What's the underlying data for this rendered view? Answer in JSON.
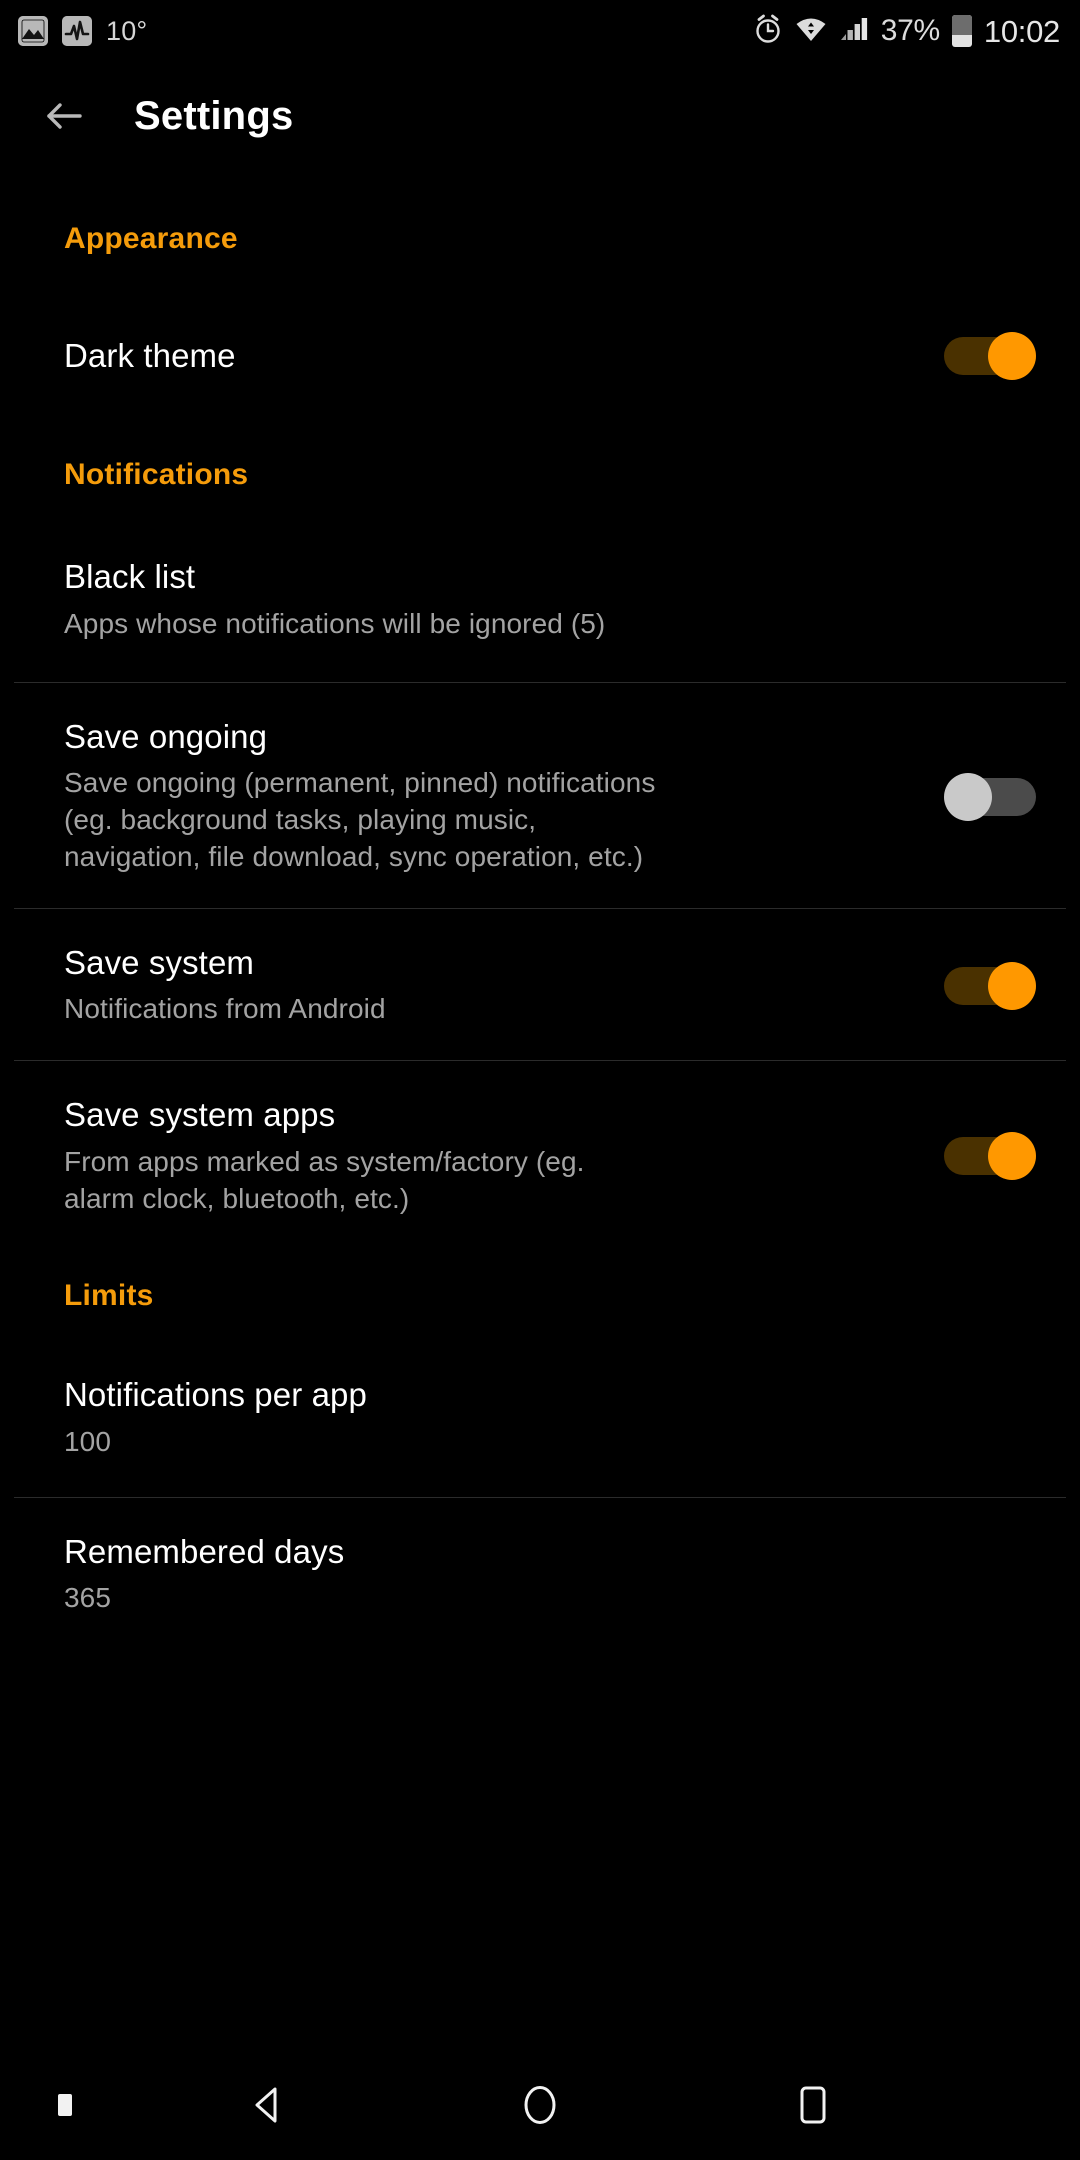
{
  "status_bar": {
    "left_icons": [
      {
        "name": "gallery-icon",
        "label": "gallery"
      },
      {
        "name": "activity-graph-icon",
        "label": "activity"
      }
    ],
    "temperature": "10°",
    "right_icons": [
      {
        "name": "alarm-icon",
        "label": "alarm"
      },
      {
        "name": "wifi-icon",
        "label": "wifi"
      },
      {
        "name": "signal-icon",
        "label": "cellular-signal"
      }
    ],
    "battery_percent": "37%",
    "clock": "10:02"
  },
  "app_bar": {
    "back_label": "Back",
    "title": "Settings"
  },
  "sections": [
    {
      "header": "Appearance",
      "rows": [
        {
          "title": "Dark theme",
          "subtitle": "",
          "control": "switch",
          "state": "on"
        }
      ]
    },
    {
      "header": "Notifications",
      "rows": [
        {
          "title": "Black list",
          "subtitle": "Apps whose notifications will be ignored (5)",
          "control": "none",
          "state": ""
        },
        {
          "title": "Save ongoing",
          "subtitle": "Save ongoing (permanent, pinned) notifications\n(eg. background tasks, playing music,\nnavigation, file download, sync operation, etc.)",
          "control": "switch",
          "state": "off"
        },
        {
          "title": "Save system",
          "subtitle": "Notifications from Android",
          "control": "switch",
          "state": "on"
        },
        {
          "title": "Save system apps",
          "subtitle": "From apps marked as system/factory (eg.\nalarm clock, bluetooth, etc.)",
          "control": "switch",
          "state": "on"
        }
      ]
    },
    {
      "header": "Limits",
      "rows": [
        {
          "title": "Notifications per app",
          "subtitle": "100",
          "control": "none",
          "state": ""
        },
        {
          "title": "Remembered days",
          "subtitle": "365",
          "control": "none",
          "state": ""
        }
      ]
    }
  ],
  "nav_bar": {
    "items": [
      {
        "name": "nav-back",
        "label": "Back"
      },
      {
        "name": "nav-home",
        "label": "Home"
      },
      {
        "name": "nav-recents",
        "label": "Recents"
      }
    ]
  },
  "colors": {
    "background": "#000000",
    "accent": "#f59c0b",
    "switch_on_thumb": "#ff9800",
    "switch_on_track": "#4a3100",
    "switch_off_thumb": "#c9c9c9",
    "switch_off_track": "#4b4b4b",
    "title_text": "#ffffff",
    "subtitle_text": "#a3a3a3",
    "divider": "#2b2b2b"
  }
}
